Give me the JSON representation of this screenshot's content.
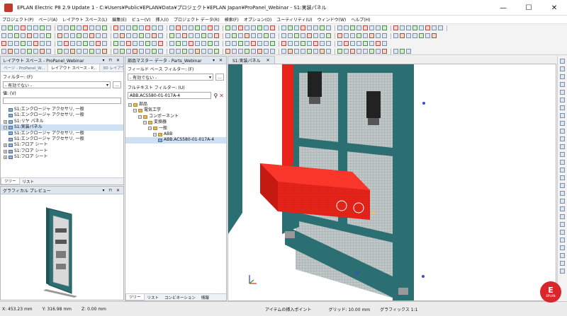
{
  "window": {
    "title": "EPLAN Electric P8 2.9 Update 1 - C:¥Users¥Public¥EPLAN¥Data¥プロジェクト¥EPLAN Japan¥ProPanel_Webinar - S1:実装パネル",
    "minimize": "—",
    "maximize": "☐",
    "close": "✕"
  },
  "menu": [
    "プロジェクト(P)",
    "ページ(A)",
    "レイアウト スペース(L)",
    "編集(E)",
    "ビュー(V)",
    "挿入(I)",
    "プロジェクト データ(R)",
    "検索(F)",
    "オプション(O)",
    "ユーティリティ(U)",
    "ウィンドウ(W)",
    "ヘルプ(H)"
  ],
  "layout_panel": {
    "title": "レイアウト スペース - ProPanel_Webinar",
    "tabs": [
      "ページ - ProPanel_W...",
      "レイアウト スペース - P...",
      "3D レイアウト - ProP..."
    ],
    "filter_label": "フィルター: (F)",
    "filter_value": "- 有効でない -",
    "value_label": "値: (V)",
    "tree": [
      {
        "text": "S1:エンクロージャ アクセサリ, 一般",
        "type": "part",
        "indent": 1
      },
      {
        "text": "S1:エンクロージャ アクセサリ, 一般",
        "type": "part",
        "indent": 1
      },
      {
        "text": "S1:リヤ パネル",
        "type": "part",
        "indent": 0,
        "expand": "+"
      },
      {
        "text": "S1:実装パネル",
        "type": "part",
        "indent": 0,
        "expand": "−",
        "selected": true
      },
      {
        "text": "S1:エンクロージャ アクセサリ, 一般",
        "type": "part",
        "indent": 1
      },
      {
        "text": "S1:エンクロージャ アクセサリ, 一般",
        "type": "part",
        "indent": 1
      },
      {
        "text": "S1:フロア シート",
        "type": "part",
        "indent": 0,
        "expand": "+"
      },
      {
        "text": "S1:フロア シート",
        "type": "part",
        "indent": 0,
        "expand": "+"
      },
      {
        "text": "S1:フロア シート",
        "type": "part",
        "indent": 0,
        "expand": "+"
      }
    ],
    "bottom_tabs": [
      "ツリー",
      "リスト"
    ]
  },
  "preview_panel": {
    "title": "グラフィカル プレビュー"
  },
  "parts_panel": {
    "title": "部品マスター データ - Parts_Webinar",
    "field_filter_label": "フィールド ベース フィルター: (F)",
    "field_filter_value": "- 有効でない -",
    "fulltext_label": "フルテキスト フィルター: (U)",
    "fulltext_value": "ABB.ACS580-01-017A-4",
    "tree": [
      {
        "text": "部品",
        "indent": 0,
        "expand": "−"
      },
      {
        "text": "電気工学",
        "indent": 1,
        "expand": "−"
      },
      {
        "text": "コンポーネント",
        "indent": 2,
        "expand": "−"
      },
      {
        "text": "変換器",
        "indent": 3,
        "expand": "−"
      },
      {
        "text": "一般",
        "indent": 4,
        "expand": "−"
      },
      {
        "text": "ABB",
        "indent": 5,
        "expand": "−"
      },
      {
        "text": "ABB.ACS580-01-017A-4",
        "indent": 6,
        "selected": true
      }
    ],
    "bottom_tabs": [
      "ツリー",
      "リスト",
      "コンビネーション",
      "情報"
    ]
  },
  "view": {
    "tab": "S1:実装パネル"
  },
  "status": {
    "x": "X: 453.23 mm",
    "y": "Y: 316.98 mm",
    "z": "Z: 0.00 mm",
    "hint": "アイテムの挿入ポイント",
    "grid": "グリッド: 10.00 mm",
    "graphics": "グラフィックス 1:1"
  },
  "logo": {
    "mark": "E",
    "text": "EPLAN"
  },
  "colors": {
    "panel_teal": "#2b6f73",
    "selected_red": "#e8241a",
    "accent": "#d8262b"
  }
}
